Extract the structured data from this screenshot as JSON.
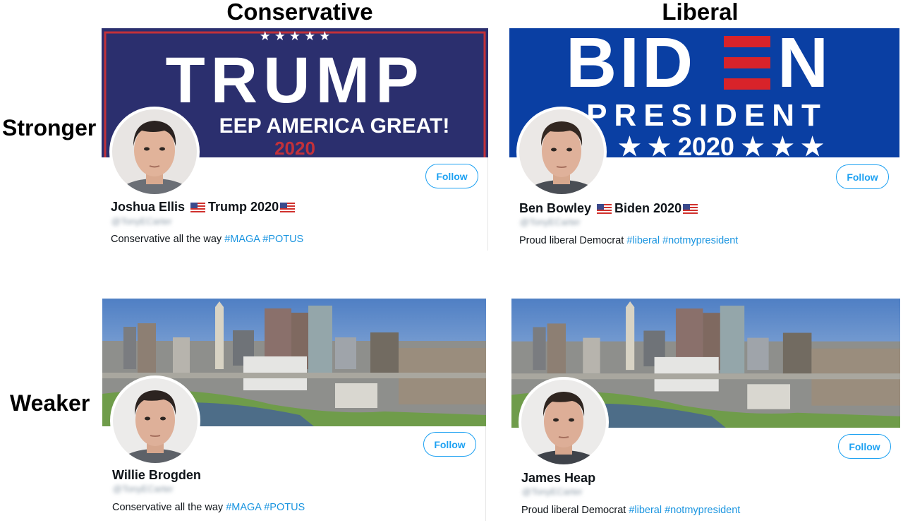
{
  "columns": {
    "left": "Conservative",
    "right": "Liberal"
  },
  "rows": {
    "top": "Stronger",
    "bottom": "Weaker"
  },
  "cards": {
    "trump": {
      "banner": {
        "stars": "★ ★ ★ ★ ★",
        "headline": "TRUMP",
        "subline": "EEP AMERICA GREAT!",
        "year": "2020"
      },
      "name": "Joshua Ellis",
      "suffix": "Trump 2020",
      "handle": "@TonyECarter",
      "bio_text": "Conservative all the way",
      "hashtags": [
        "#MAGA",
        "#POTUS"
      ],
      "follow_label": "Follow"
    },
    "biden": {
      "banner": {
        "headline_a": "BID",
        "headline_b": "N",
        "subline": "PRESIDENT",
        "year": "★ ★ 2020 ★ ★ ★"
      },
      "name": "Ben Bowley",
      "suffix": "Biden 2020",
      "handle": "@TonyECarter",
      "bio_text": "Proud liberal Democrat",
      "hashtags": [
        "#liberal",
        "#notmypresident"
      ],
      "follow_label": "Follow"
    },
    "willie": {
      "name": "Willie Brogden",
      "handle": "@TonyECarter",
      "bio_text": "Conservative all the way",
      "hashtags": [
        "#MAGA",
        "#POTUS"
      ],
      "follow_label": "Follow"
    },
    "james": {
      "name": "James Heap",
      "handle": "@TonyECarter",
      "bio_text": "Proud liberal Democrat",
      "hashtags": [
        "#liberal",
        "#notmypresident"
      ],
      "follow_label": "Follow"
    }
  },
  "icons": {
    "flag": "us-flag-icon",
    "avatar": "profile-photo"
  },
  "colors": {
    "twitter_blue": "#1da1f2",
    "hashtag_blue": "#1b95e0",
    "trump_navy": "#2b2f6e",
    "biden_blue": "#0a3fa3",
    "flag_red": "#d0312d"
  }
}
